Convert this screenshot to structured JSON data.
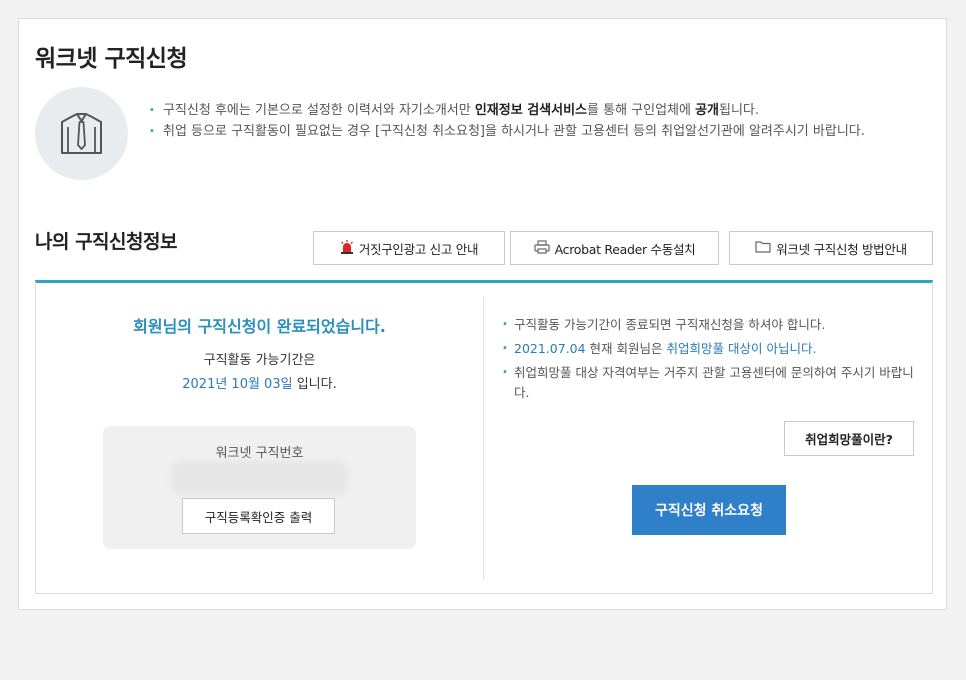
{
  "page": {
    "title": "워크넷 구직신청"
  },
  "notice": {
    "item1_pre": "구직신청 후에는 기본으로 설정한 이력서와 자기소개서만 ",
    "item1_bold1": "인재정보 검색서비스",
    "item1_mid": "를 통해 구인업체에 ",
    "item1_bold2": "공개",
    "item1_post": "됩니다.",
    "item2": "취업 등으로 구직활동이 필요없는 경우 [구직신청 취소요청]을 하시거나 관할 고용센터 등의 취업알선기관에 알려주시기 바랍니다."
  },
  "section": {
    "title": "나의 구직신청정보",
    "buttons": {
      "report": "거짓구인광고 신고 안내",
      "acrobat": "Acrobat Reader 수동설치",
      "guide": "워크넷 구직신청 방법안내"
    }
  },
  "status": {
    "complete_message": "회원님의 구직신청이 완료되었습니다.",
    "period_label": "구직활동 가능기간은",
    "period_date": "2021년 10월 03일",
    "period_suffix": " 입니다.",
    "reg_number_label": "워크넷 구직번호",
    "print_button": "구직등록확인증 출력"
  },
  "notes": {
    "item1": "구직활동 가능기간이 종료되면 구직재신청을 하셔야 합니다.",
    "item2_date": "2021.07.04",
    "item2_mid": " 현재 회원님은 ",
    "item2_link": "취업희망풀 대상이 아닙니다.",
    "item3": "취업희망풀 대상 자격여부는 거주지 관할 고용센터에 문의하여 주시기 바랍니다.",
    "pool_button": "취업희망풀이란?",
    "cancel_button": "구직신청 취소요청"
  },
  "colors": {
    "accent": "#30a4c8",
    "primary_button": "#2f80c9",
    "link": "#2a7ab8"
  },
  "icons": [
    "shirt-tie-icon",
    "siren-icon",
    "printer-icon",
    "folder-icon"
  ]
}
